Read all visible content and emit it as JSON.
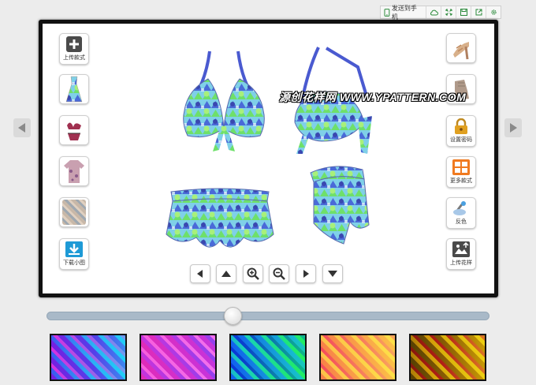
{
  "toolbar": {
    "send_to_phone": "发送到手机",
    "icons": [
      "cloud-icon",
      "expand-icon",
      "save-icon",
      "share-icon",
      "settings-icon"
    ]
  },
  "left_tools": {
    "upload_style": "上传款式",
    "download_thumb": "下载小图"
  },
  "right_tools": {
    "set_password": "设置密码",
    "more_styles": "更多款式",
    "invert_color": "反色",
    "upload_pattern": "上传花样"
  },
  "watermark": "源创花样网 WWW.YPATTERN.COM",
  "slider": {
    "value": 0.42
  },
  "colors": {
    "canvas_border": "#111111",
    "slider_track": "#a9b9c8",
    "icon_dark": "#4a4a4a",
    "lock_gold": "#e0a020",
    "download_blue": "#1e9ad6"
  },
  "swatches": [
    {
      "name": "purple-blue",
      "c1": "#7a3fc0",
      "c2": "#3fb0e0",
      "c3": "#e060c0"
    },
    {
      "name": "pink-purple",
      "c1": "#c04aa0",
      "c2": "#8a5ad0",
      "c3": "#f0a0d0"
    },
    {
      "name": "green-blue",
      "c1": "#2f6fd0",
      "c2": "#40d070",
      "c3": "#1a3f9a"
    },
    {
      "name": "orange-pink",
      "c1": "#e08060",
      "c2": "#f0c060",
      "c3": "#d04a7a"
    },
    {
      "name": "gold-olive",
      "c1": "#6a5a10",
      "c2": "#d0b030",
      "c3": "#a02060"
    }
  ]
}
